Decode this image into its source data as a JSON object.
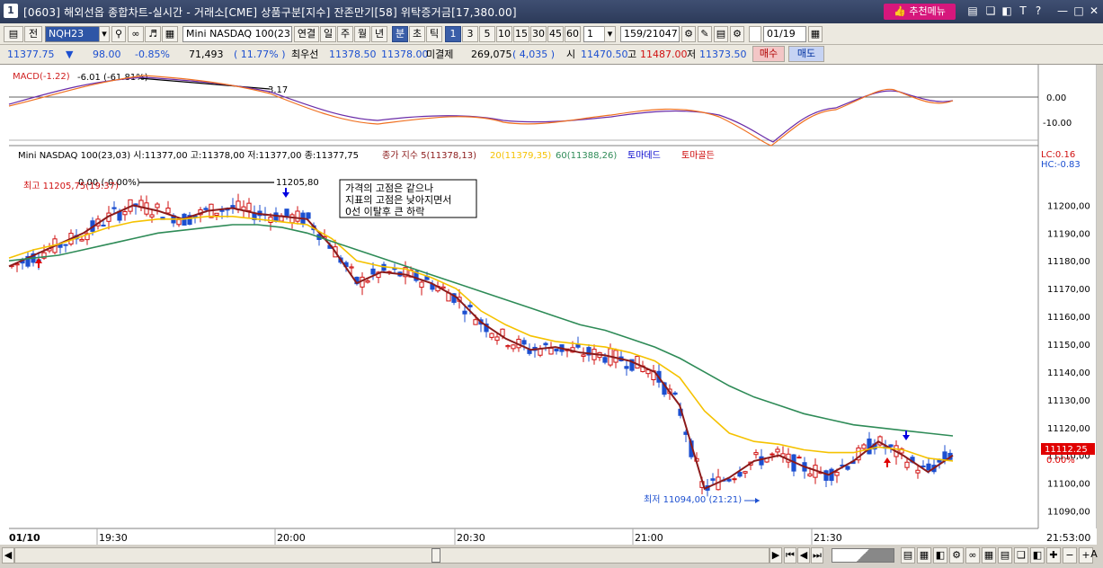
{
  "window": {
    "number": "1",
    "title": "[0603] 해외선옵 종합차트-실시간 - 거래소[CME] 상품구분[지수] 잔존만기[58] 위탁증거금[17,380.00]",
    "recommend_button": "추천메뉴",
    "icons": [
      "window-list-icon",
      "copy-icon",
      "new-window-icon",
      "font-icon",
      "help-icon",
      "minimize-icon",
      "maximize-icon",
      "close-icon"
    ]
  },
  "toolbar": {
    "prev_label": "전",
    "symbol_code": "NQH23",
    "symbol_name": "Mini NASDAQ 100(23.0",
    "periods": [
      "연결",
      "일",
      "주",
      "월",
      "년",
      "분",
      "초",
      "틱"
    ],
    "selected_period": "분",
    "intervals": [
      "1",
      "3",
      "5",
      "10",
      "15",
      "30",
      "45",
      "60"
    ],
    "selected_interval": "1",
    "interval_input": "1",
    "count": "159/21047",
    "date": "01/19"
  },
  "quote": {
    "price": "11377.75",
    "change_arrow": "▼",
    "change": "98.00",
    "change_pct": "-0.85%",
    "volume": "71,493",
    "volume_ratio": "( 11.77% )",
    "bid_label": "최우선",
    "bid": "11378.50",
    "ask": "11378.00",
    "open_interest_label": "미결제",
    "open_interest": "269,075",
    "oi_change": "( 4,035 )",
    "open_label": "시",
    "open": "11470.50",
    "high_label": "고",
    "high": "11487.00",
    "low_label": "저",
    "low": "11373.50",
    "buy_button": "매수",
    "sell_button": "매도"
  },
  "macd_panel": {
    "label": "MACD(-1.22)",
    "line_start_label": "-6.01 (-61.81%)",
    "line_end_label": "3.17",
    "axis_labels": [
      "0.00",
      "-10.00"
    ]
  },
  "price_panel": {
    "header": "Mini NASDAQ 100(23,03) 시:11377,00 고:11378,00 저:11377,00 종:11377,75",
    "ma_legend": [
      {
        "label": "종가 지수 5(11378,13)",
        "color": "#8b1a1a"
      },
      {
        "label": "20(11379,35)",
        "color": "#f5c200"
      },
      {
        "label": "60(11388,26)",
        "color": "#2e8b57"
      },
      {
        "label": "토마데드",
        "color": "#0000cc"
      },
      {
        "label": "토마골든",
        "color": "#cc0000"
      }
    ],
    "lc_label": "LC:0.16",
    "hc_label": "HC:-0.83",
    "high_annotation": "최고 11205,75(19:37)",
    "trend_start_label": "0.00 (-0.00%)",
    "trend_end_label": "11205,80",
    "low_annotation": "최저 11094,00 (21:21)",
    "comment_lines": [
      "가격의 고점은 같으나",
      "지표의 고점은 낮아지면서",
      "0선 이탈후 큰 하락"
    ],
    "current_price_tag": "11112.25",
    "current_pct_tag": "0.00%",
    "y_ticks": [
      "11200,00",
      "11190,00",
      "11180,00",
      "11170,00",
      "11160,00",
      "11150,00",
      "11140,00",
      "11130,00",
      "11120,00",
      "11110,00",
      "11100,00",
      "11090,00"
    ],
    "x_ticks": [
      "01/10",
      "19:30",
      "20:00",
      "20:30",
      "21:00",
      "21:30",
      "21:53:00"
    ]
  },
  "chart_data": {
    "type": "candlestick",
    "ylim": [
      11085,
      11215
    ],
    "series": [
      {
        "name": "5",
        "values": [
          11178,
          11182,
          11186,
          11190,
          11196,
          11200,
          11198,
          11195,
          11198,
          11199,
          11197,
          11196,
          11195,
          11185,
          11172,
          11176,
          11175,
          11172,
          11167,
          11158,
          11152,
          11148,
          11149,
          11147,
          11146,
          11144,
          11140,
          11128,
          11098,
          11102,
          11108,
          11110,
          11106,
          11103,
          11108,
          11115,
          11110,
          11104,
          11110
        ]
      },
      {
        "name": "20",
        "values": [
          11181,
          11184,
          11186,
          11189,
          11192,
          11194,
          11195,
          11195,
          11196,
          11196,
          11195,
          11194,
          11193,
          11188,
          11180,
          11178,
          11177,
          11174,
          11170,
          11162,
          11157,
          11153,
          11151,
          11150,
          11149,
          11147,
          11144,
          11138,
          11126,
          11118,
          11115,
          11114,
          11112,
          11111,
          11111,
          11113,
          11112,
          11109,
          11108
        ]
      },
      {
        "name": "60",
        "values": [
          11180,
          11181,
          11182,
          11184,
          11186,
          11188,
          11190,
          11191,
          11192,
          11193,
          11193,
          11192,
          11190,
          11187,
          11184,
          11181,
          11178,
          11175,
          11172,
          11169,
          11166,
          11163,
          11160,
          11157,
          11155,
          11152,
          11149,
          11145,
          11140,
          11135,
          11131,
          11128,
          11125,
          11123,
          11121,
          11120,
          11119,
          11118,
          11117
        ]
      }
    ]
  }
}
